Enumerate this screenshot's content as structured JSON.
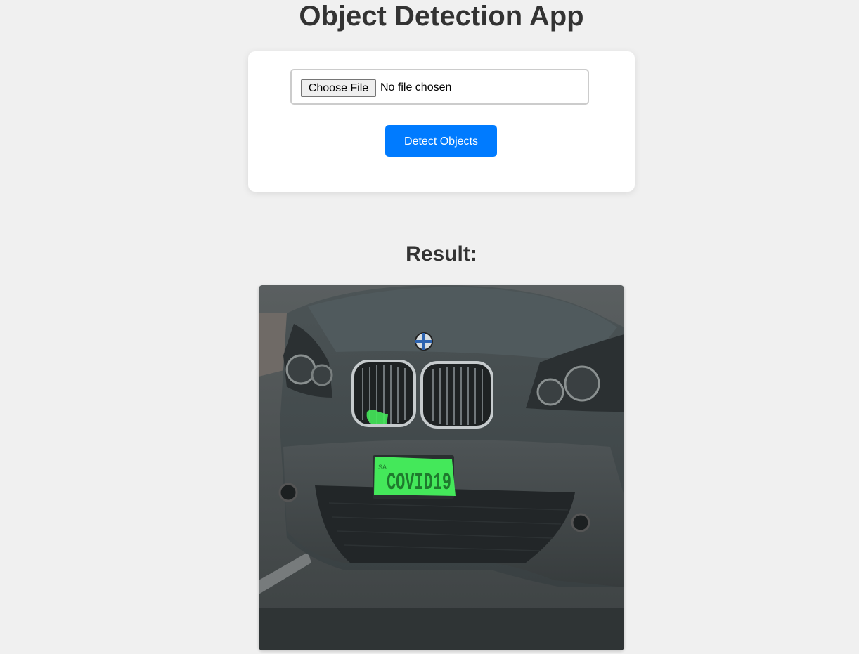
{
  "app": {
    "title": "Object Detection App"
  },
  "upload": {
    "choose_file_label": "Choose File",
    "file_status": "No file chosen",
    "detect_button_label": "Detect Objects"
  },
  "result": {
    "heading": "Result:",
    "image_subject": "grey car front with license plate highlighted",
    "plate_text": "COVID19",
    "plate_state": "SA"
  },
  "colors": {
    "background": "#f0f0f0",
    "primary_button": "#007bff",
    "detection_highlight": "#44e85a"
  }
}
